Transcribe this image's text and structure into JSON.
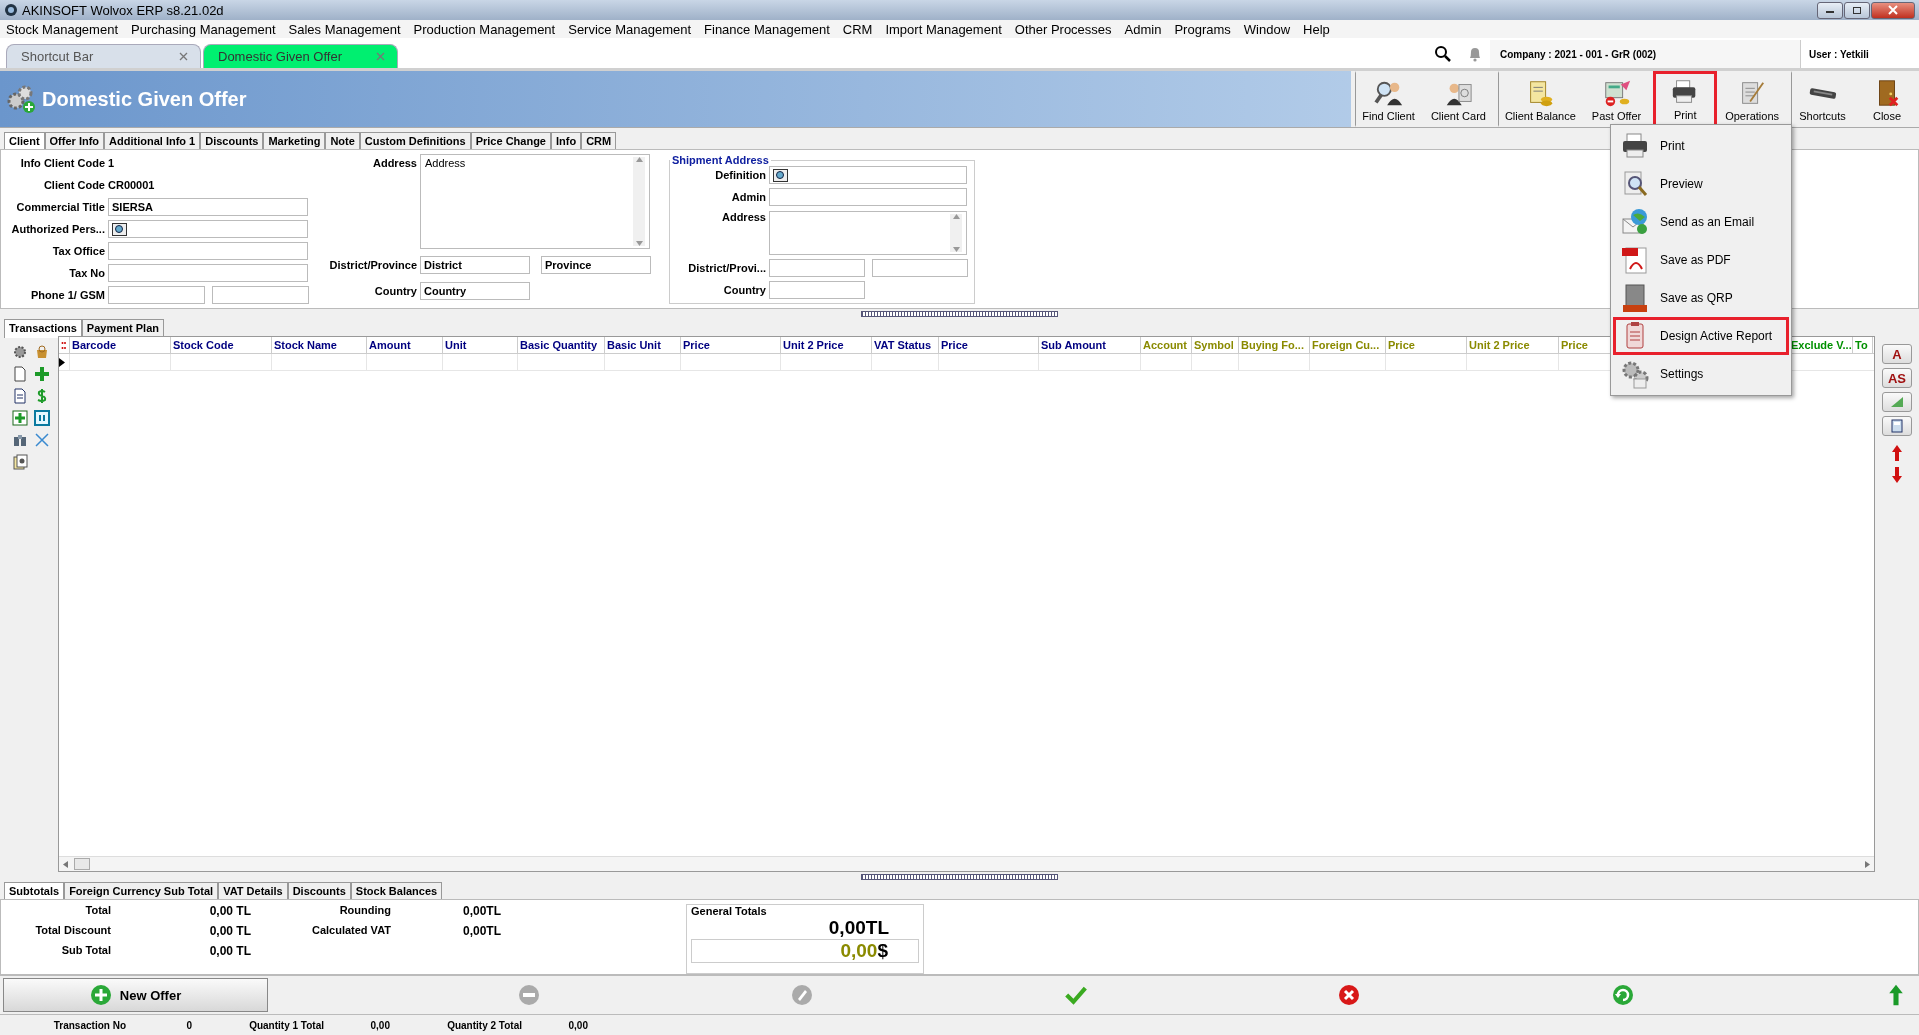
{
  "window": {
    "title": "AKINSOFT Wolvox ERP s8.21.02d"
  },
  "menu": [
    "Stock Management",
    "Purchasing Management",
    "Sales Management",
    "Production Management",
    "Service Management",
    "Finance Management",
    "CRM",
    "Import Management",
    "Other Processes",
    "Admin",
    "Programs",
    "Window",
    "Help"
  ],
  "doc_tabs": [
    {
      "label": "Shortcut Bar",
      "selected": false
    },
    {
      "label": "Domestic Given Offer",
      "selected": true
    }
  ],
  "company": "Company : 2021 - 001 - GrR (002)",
  "user": "User : Yetkili",
  "header": {
    "title": "Domestic Given Offer"
  },
  "toolbar": [
    {
      "label": "Find Client",
      "highlighted": false,
      "group_start": true
    },
    {
      "label": "Client Card",
      "highlighted": false,
      "group_start": false
    },
    {
      "label": "Client Balance",
      "highlighted": false,
      "group_start": true
    },
    {
      "label": "Past Offer",
      "highlighted": false,
      "group_start": false
    },
    {
      "label": "Print",
      "highlighted": true,
      "group_start": true
    },
    {
      "label": "Operations",
      "highlighted": false,
      "group_start": false
    },
    {
      "label": "Shortcuts",
      "highlighted": false,
      "group_start": true
    },
    {
      "label": "Close",
      "highlighted": false,
      "group_start": false
    }
  ],
  "form_tabs": [
    {
      "label": "Client",
      "selected": true
    },
    {
      "label": "Offer Info",
      "selected": false
    },
    {
      "label": "Additional Info 1",
      "selected": false
    },
    {
      "label": "Discounts",
      "selected": false
    },
    {
      "label": "Marketing",
      "selected": false
    },
    {
      "label": "Note",
      "selected": false
    },
    {
      "label": "Custom Definitions",
      "selected": false
    },
    {
      "label": "Price Change",
      "selected": false
    },
    {
      "label": "Info",
      "selected": false
    },
    {
      "label": "CRM",
      "selected": false
    }
  ],
  "client_fields": [
    {
      "kind": "text",
      "label": "Info Client Code",
      "value": "1"
    },
    {
      "kind": "text",
      "label": "Client Code",
      "value": "CR00001"
    },
    {
      "kind": "field",
      "label": "Commercial Title",
      "value": "SIERSA"
    },
    {
      "kind": "lookup",
      "label": "Authorized Pers..."
    },
    {
      "kind": "field",
      "label": "Tax Office"
    },
    {
      "kind": "field",
      "label": "Tax No"
    },
    {
      "kind": "pair",
      "label": "Phone 1/ GSM"
    }
  ],
  "address": {
    "label": "Address",
    "value": "Address"
  },
  "district": {
    "label": "District/Province",
    "values": [
      "District",
      "Province"
    ]
  },
  "country": {
    "label": "Country",
    "value": "Country"
  },
  "shipment": {
    "title": "Shipment Address",
    "fields": [
      {
        "kind": "lookup",
        "label": "Definition"
      },
      {
        "kind": "field",
        "label": "Admin"
      },
      {
        "kind": "memo",
        "label": "Address"
      },
      {
        "kind": "pair",
        "label": "District/Provi..."
      },
      {
        "kind": "short",
        "label": "Country"
      }
    ]
  },
  "sub_tabs": [
    {
      "label": "Transactions",
      "selected": true
    },
    {
      "label": "Payment Plan",
      "selected": false
    }
  ],
  "columns": [
    {
      "label": "Barcode",
      "color": "#000080"
    },
    {
      "label": "Stock Code",
      "color": "#000080"
    },
    {
      "label": "Stock Name",
      "color": "#000080"
    },
    {
      "label": "Amount",
      "color": "#000080"
    },
    {
      "label": "Unit",
      "color": "#000080"
    },
    {
      "label": "Basic Quantity",
      "color": "#000080"
    },
    {
      "label": "Basic Unit",
      "color": "#000080"
    },
    {
      "label": "Price",
      "color": "#000080"
    },
    {
      "label": "Unit 2 Price",
      "color": "#000080"
    },
    {
      "label": "VAT Status",
      "color": "#000080"
    },
    {
      "label": "Price",
      "color": "#000080"
    },
    {
      "label": "Sub Amount",
      "color": "#000080"
    },
    {
      "label": "Account",
      "color": "#8a8a00"
    },
    {
      "label": "Symbol",
      "color": "#8a8a00"
    },
    {
      "label": "Buying Fo...",
      "color": "#8a8a00"
    },
    {
      "label": "Foreign Cu...",
      "color": "#8a8a00"
    },
    {
      "label": "Price",
      "color": "#8a8a00"
    },
    {
      "label": "Unit 2 Price",
      "color": "#8a8a00"
    },
    {
      "label": "Price",
      "color": "#8a8a00"
    },
    {
      "label": "Exclude V...",
      "color": "#009000"
    },
    {
      "label": "To",
      "color": "#009000"
    }
  ],
  "side_buttons": [
    "A",
    "AS"
  ],
  "print_menu": [
    {
      "label": "Print",
      "highlighted": false
    },
    {
      "label": "Preview",
      "highlighted": false
    },
    {
      "label": "Send as an Email",
      "highlighted": false
    },
    {
      "label": "Save as PDF",
      "highlighted": false
    },
    {
      "label": "Save as QRP",
      "highlighted": false
    },
    {
      "label": "Design Active Report",
      "highlighted": true
    },
    {
      "label": "Settings",
      "highlighted": false
    }
  ],
  "total_tabs": [
    {
      "label": "Subtotals",
      "selected": true
    },
    {
      "label": "Foreign Currency Sub Total",
      "selected": false
    },
    {
      "label": "VAT Details",
      "selected": false
    },
    {
      "label": "Discounts",
      "selected": false
    },
    {
      "label": "Stock Balances",
      "selected": false
    }
  ],
  "totals_left": [
    {
      "label": "Total",
      "value": "0,00 TL"
    },
    {
      "label": "Total Discount",
      "value": "0,00 TL"
    },
    {
      "label": "Sub Total",
      "value": "0,00 TL"
    }
  ],
  "totals_mid": [
    {
      "label": "Rounding",
      "value": "0,00TL"
    },
    {
      "label": "Calculated VAT",
      "value": "0,00TL"
    }
  ],
  "general_totals": {
    "title": "General Totals",
    "lines": [
      {
        "amount": "0,00TL",
        "color": "#000000"
      },
      {
        "amount": "0,00",
        "currency": "$",
        "color": "#8a8a00"
      }
    ]
  },
  "actions": [
    {
      "kind": "new",
      "label": "New Offer",
      "disabled": false
    },
    {
      "kind": "minus",
      "disabled": true
    },
    {
      "kind": "edit",
      "disabled": true
    },
    {
      "kind": "save",
      "disabled": false
    },
    {
      "kind": "cancel",
      "disabled": false
    },
    {
      "kind": "refresh",
      "disabled": false
    },
    {
      "kind": "up",
      "disabled": false
    }
  ],
  "status": [
    {
      "label": "Transaction No",
      "value": "0"
    },
    {
      "label": "Quantity 1 Total",
      "value": "0,00"
    },
    {
      "label": "Quantity 2 Total",
      "value": "0,00"
    }
  ]
}
